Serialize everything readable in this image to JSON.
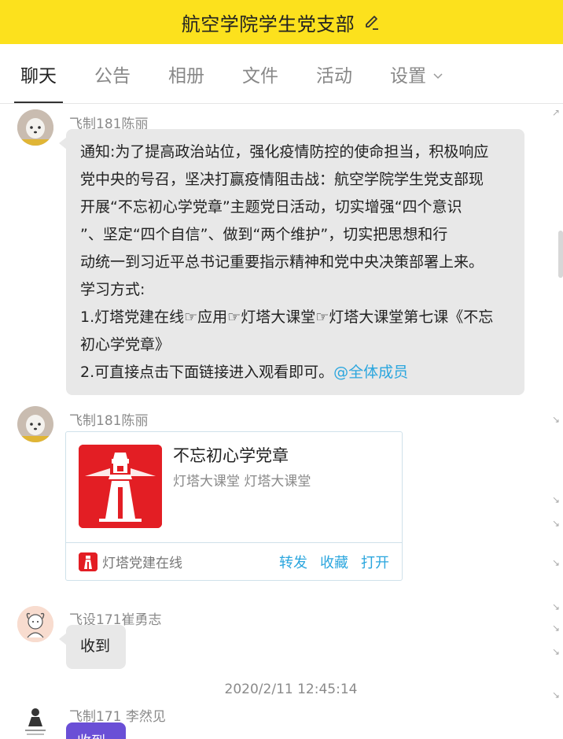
{
  "header": {
    "title": "航空学院学生党支部",
    "edit_icon": "pencil-icon"
  },
  "tabs": [
    {
      "label": "聊天",
      "active": true
    },
    {
      "label": "公告"
    },
    {
      "label": "相册"
    },
    {
      "label": "文件"
    },
    {
      "label": "活动"
    },
    {
      "label": "设置",
      "has_dropdown": true
    }
  ],
  "messages": [
    {
      "sender": "飞制181陈丽",
      "lines": [
        "通知:为了提高政治站位，强化疫情防控的使命担当，积极响应",
        "党中央的号召，坚决打赢疫情阻击战：航空学院学生党支部现",
        "开展“不忘初心学党章”主题党日活动，切实增强“四个意识",
        "”、坚定“四个自信”、做到“两个维护”，切实把思想和行",
        "动统一到习近平总书记重要指示精神和党中央决策部署上来。",
        "学习方式:",
        "1.灯塔党建在线☞应用☞灯塔大课堂☞灯塔大课堂第七课《不忘",
        "初心学党章》"
      ],
      "last_line": "2.可直接点击下面链接进入观看即可。",
      "mention": "@全体成员"
    },
    {
      "sender": "飞制181陈丽",
      "card": {
        "title": "不忘初心学党章",
        "subtitle": "灯塔大课堂 灯塔大课堂",
        "app_name": "灯塔党建在线",
        "actions": [
          "转发",
          "收藏",
          "打开"
        ]
      }
    },
    {
      "sender": "飞设171崔勇志",
      "text": "收到"
    }
  ],
  "timestamp": "2020/2/11 12:45:14",
  "last_message": {
    "sender": "飞制171 李然见",
    "text": "收到"
  },
  "colors": {
    "header_bg": "#fce11d",
    "link": "#2ba6de",
    "bubble_bg": "#e8e8e8",
    "card_red": "#e31e24"
  }
}
